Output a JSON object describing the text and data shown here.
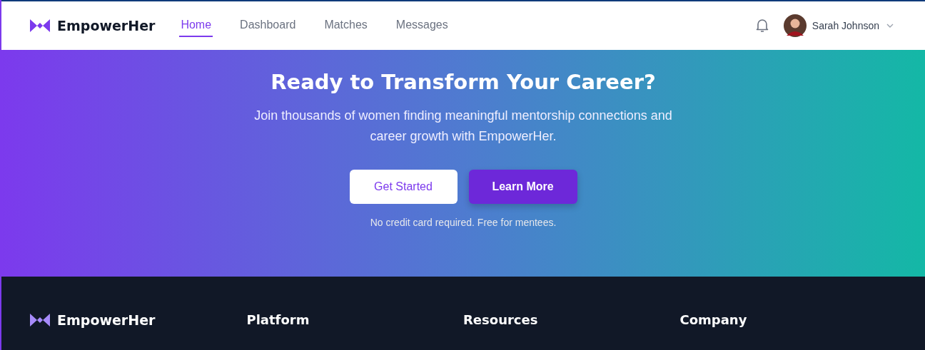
{
  "nav": {
    "brand": "EmpowerHer",
    "links": [
      {
        "label": "Home",
        "selected": true
      },
      {
        "label": "Dashboard",
        "selected": false
      },
      {
        "label": "Matches",
        "selected": false
      },
      {
        "label": "Messages",
        "selected": false
      }
    ],
    "user": {
      "name": "Sarah Johnson"
    }
  },
  "hero": {
    "title": "Ready to Transform Your Career?",
    "subtitle": "Join thousands of women finding meaningful mentorship connections and career growth with EmpowerHer.",
    "buttons": [
      {
        "label": "Get Started",
        "kind": "secondary"
      },
      {
        "label": "Learn More",
        "kind": "primary"
      }
    ],
    "note": "No credit card required. Free for mentees."
  },
  "footer": {
    "brand": "EmpowerHer",
    "columns": [
      {
        "title": "Platform"
      },
      {
        "title": "Resources"
      },
      {
        "title": "Company"
      }
    ]
  }
}
